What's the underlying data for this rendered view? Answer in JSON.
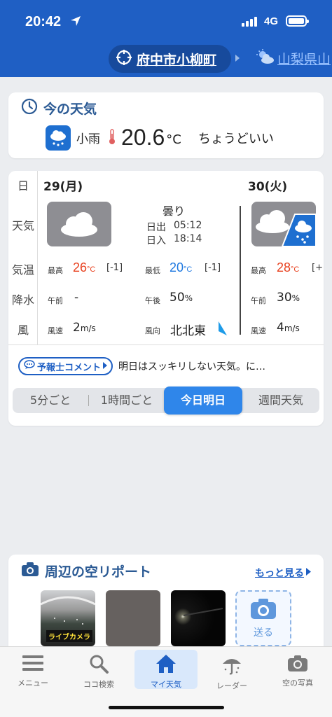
{
  "status_bar": {
    "time": "20:42",
    "network": "4G"
  },
  "header": {
    "location": "府中市小柳町",
    "next_location": "山梨県山"
  },
  "current": {
    "title": "今の天気",
    "condition": "小雨",
    "temperature": "20.6",
    "unit": "°C",
    "feeling": "ちょうどいい"
  },
  "forecast": {
    "row_labels": {
      "day": "日",
      "weather": "天気",
      "temp": "気温",
      "precip": "降水",
      "wind": "風"
    },
    "today": {
      "date": "29(月)",
      "condition": "曇り",
      "sunrise_label": "日出",
      "sunrise": "05:12",
      "sunset_label": "日入",
      "sunset": "18:14",
      "high_label": "最高",
      "high": "26",
      "high_diff": "[-1]",
      "low_label": "最低",
      "low": "20",
      "low_diff": "[-1]",
      "am_label": "午前",
      "am_precip": "-",
      "pm_label": "午後",
      "pm_precip": "50",
      "wind_speed_label": "風速",
      "wind_speed": "2",
      "wind_speed_unit": "m/s",
      "wind_dir_label": "風向",
      "wind_dir": "北北東"
    },
    "tomorrow": {
      "date": "30(火)",
      "high_label": "最高",
      "high": "28",
      "high_diff": "[+",
      "am_label": "午前",
      "am_precip": "30",
      "wind_speed_label": "風速",
      "wind_speed": "4",
      "wind_speed_unit": "m/s"
    },
    "temp_unit": "°C",
    "percent_unit": "%"
  },
  "comment": {
    "label": "予報士コメント",
    "text": "明日はスッキリしない天気。に…"
  },
  "tabs": [
    {
      "label": "5分ごと"
    },
    {
      "label": "1時間ごと"
    },
    {
      "label": "今日明日"
    },
    {
      "label": "週間天気"
    }
  ],
  "sky_report": {
    "title": "周辺の空リポート",
    "more": "もっと見る",
    "live_tag": "ライブカメラ",
    "send": "送る"
  },
  "nav": [
    {
      "label": "メニュー",
      "icon": "menu-icon"
    },
    {
      "label": "ココ検索",
      "icon": "search-icon"
    },
    {
      "label": "マイ天気",
      "icon": "home-icon"
    },
    {
      "label": "レーダー",
      "icon": "umbrella-icon"
    },
    {
      "label": "空の写真",
      "icon": "camera-icon"
    }
  ],
  "colors": {
    "header_blue": "#1f5fc4",
    "high_temp": "#e8401e",
    "low_temp": "#1e78e0",
    "active_tab": "#2f86ea"
  }
}
